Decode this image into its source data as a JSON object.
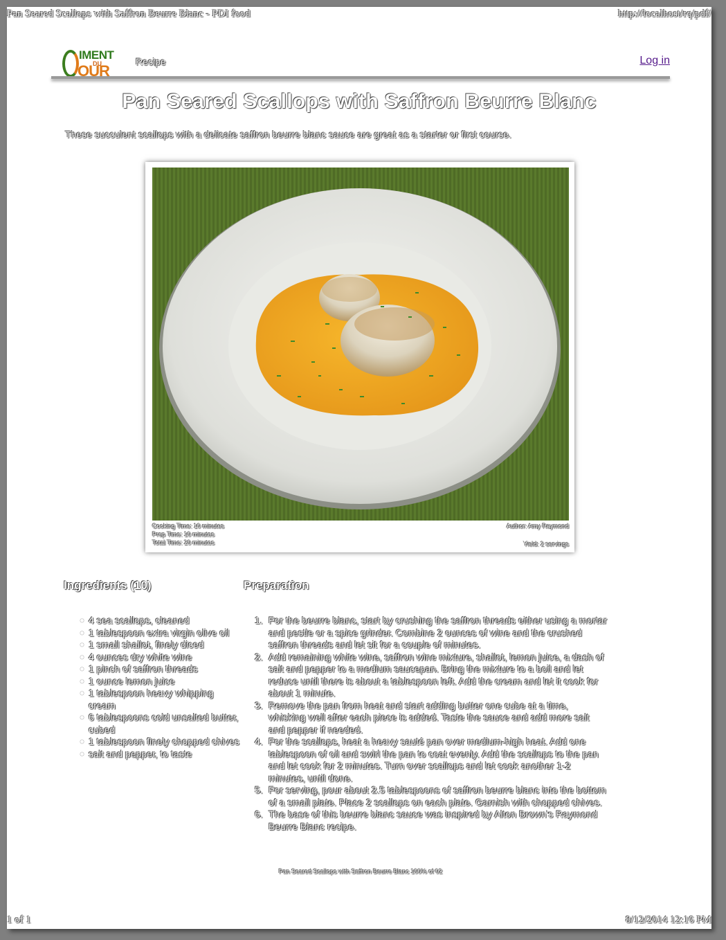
{
  "print": {
    "header_left": "Pan Seared Scallops with Saffron Beurre Blanc - PDI food",
    "header_right": "http://localhost/rq/pdf/",
    "footer_left": "1 of 1",
    "footer_right": "8/12/2014 12:16 PM"
  },
  "site": {
    "logo_line1": "IMENT",
    "logo_du": "DU",
    "logo_line2": "OUR",
    "nav_recipe": "Recipe",
    "login": "Log in"
  },
  "recipe": {
    "title": "Pan Seared Scallops with Saffron Beurre Blanc",
    "intro": "These succulent scallops with a delicate saffron beurre blanc sauce are great as a starter or first course.",
    "cooking_time": "Cooking Time: 10 minutes",
    "prep_time": "Prep Time: 10 minutes",
    "total_time": "Total Time: 20 minutes",
    "author": "Author: Amy Raymond",
    "yield": "Yield: 2 servings",
    "ingredients_heading": "Ingredients (10)",
    "preparation_heading": "Preparation",
    "ingredients": [
      "4 sea scallops, cleaned",
      "1 tablespoon extra virgin olive oil",
      "1 small shallot, finely diced",
      "4 ounces dry white wine",
      "1 pinch of saffron threads",
      "1 ounce lemon juice",
      "1 tablespoon heavy whipping cream",
      "6 tablespoons cold unsalted butter, cubed",
      "1 tablespoon finely chopped chives",
      "salt and pepper, to taste"
    ],
    "steps": [
      {
        "num": "1.",
        "text": "For the beurre blanc, start by crushing the saffron threads either using a mortar and pestle or a spice grinder. Combine 2 ounces of wine and the crushed saffron threads and let sit for a couple of minutes."
      },
      {
        "num": "2.",
        "text": "Add remaining white wine, saffron wine mixture, shallot, lemon juice, a dash of salt and pepper to a medium saucepan. Bring the mixture to a boil and let reduce until there is about a tablespoon left. Add the cream and let it cook for about 1 minute."
      },
      {
        "num": "3.",
        "text": "Remove the pan from heat and start adding butter one cube at a time, whisking well after each piece is added. Taste the sauce and add more salt and pepper if needed."
      },
      {
        "num": "4.",
        "text": "For the scallops, heat a heavy sauté pan over medium-high heat. Add one tablespoon of oil and swirl the pan to coat evenly. Add the scallops to the pan and let cook for 2 minutes. Turn over scallops and let cook another 1-2 minutes, until done."
      },
      {
        "num": "5.",
        "text": "For serving, pour about 2.5 tablespoons of saffron beurre blanc into the bottom of a small plate. Place 2 scallops on each plate. Garnish with chopped chives."
      },
      {
        "num": "6.",
        "text": "The base of this beurre blanc sauce was inspired by Alton Brown's Raymond Beurre Blanc recipe."
      }
    ],
    "bottom_note": "Pan Seared Scallops with Saffron Beurre Blanc 100% of 02"
  },
  "colors": {
    "page_bg": "#7f7f7f",
    "paper": "#ffffff",
    "logo_green": "#2f7a1d",
    "logo_orange": "#e07b1a",
    "link": "#551a8b",
    "placemat": "#4f6b26",
    "sauce": "#f0a820"
  }
}
